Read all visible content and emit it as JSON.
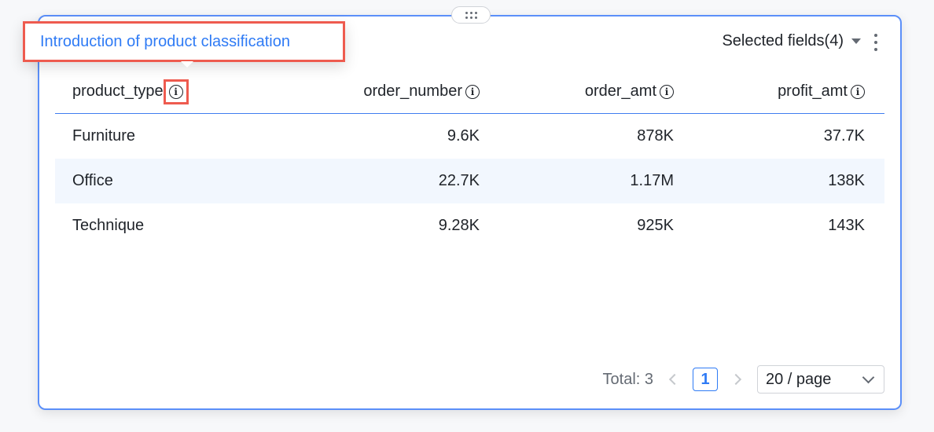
{
  "tooltip": {
    "text": "Introduction of product classification"
  },
  "toolbar": {
    "fields_label": "Selected fields(4)"
  },
  "table": {
    "columns": [
      {
        "label": "product_type"
      },
      {
        "label": "order_number"
      },
      {
        "label": "order_amt"
      },
      {
        "label": "profit_amt"
      }
    ],
    "rows": [
      {
        "product_type": "Furniture",
        "order_number": "9.6K",
        "order_amt": "878K",
        "profit_amt": "37.7K"
      },
      {
        "product_type": "Office",
        "order_number": "22.7K",
        "order_amt": "1.17M",
        "profit_amt": "138K"
      },
      {
        "product_type": "Technique",
        "order_number": "9.28K",
        "order_amt": "925K",
        "profit_amt": "143K"
      }
    ]
  },
  "pagination": {
    "total_label": "Total: 3",
    "current_page": "1",
    "page_size": "20 / page"
  },
  "colors": {
    "accent": "#2f7bf5",
    "highlight_border": "#ee5b4f",
    "selected_row_bg": "#f2f7fe"
  }
}
